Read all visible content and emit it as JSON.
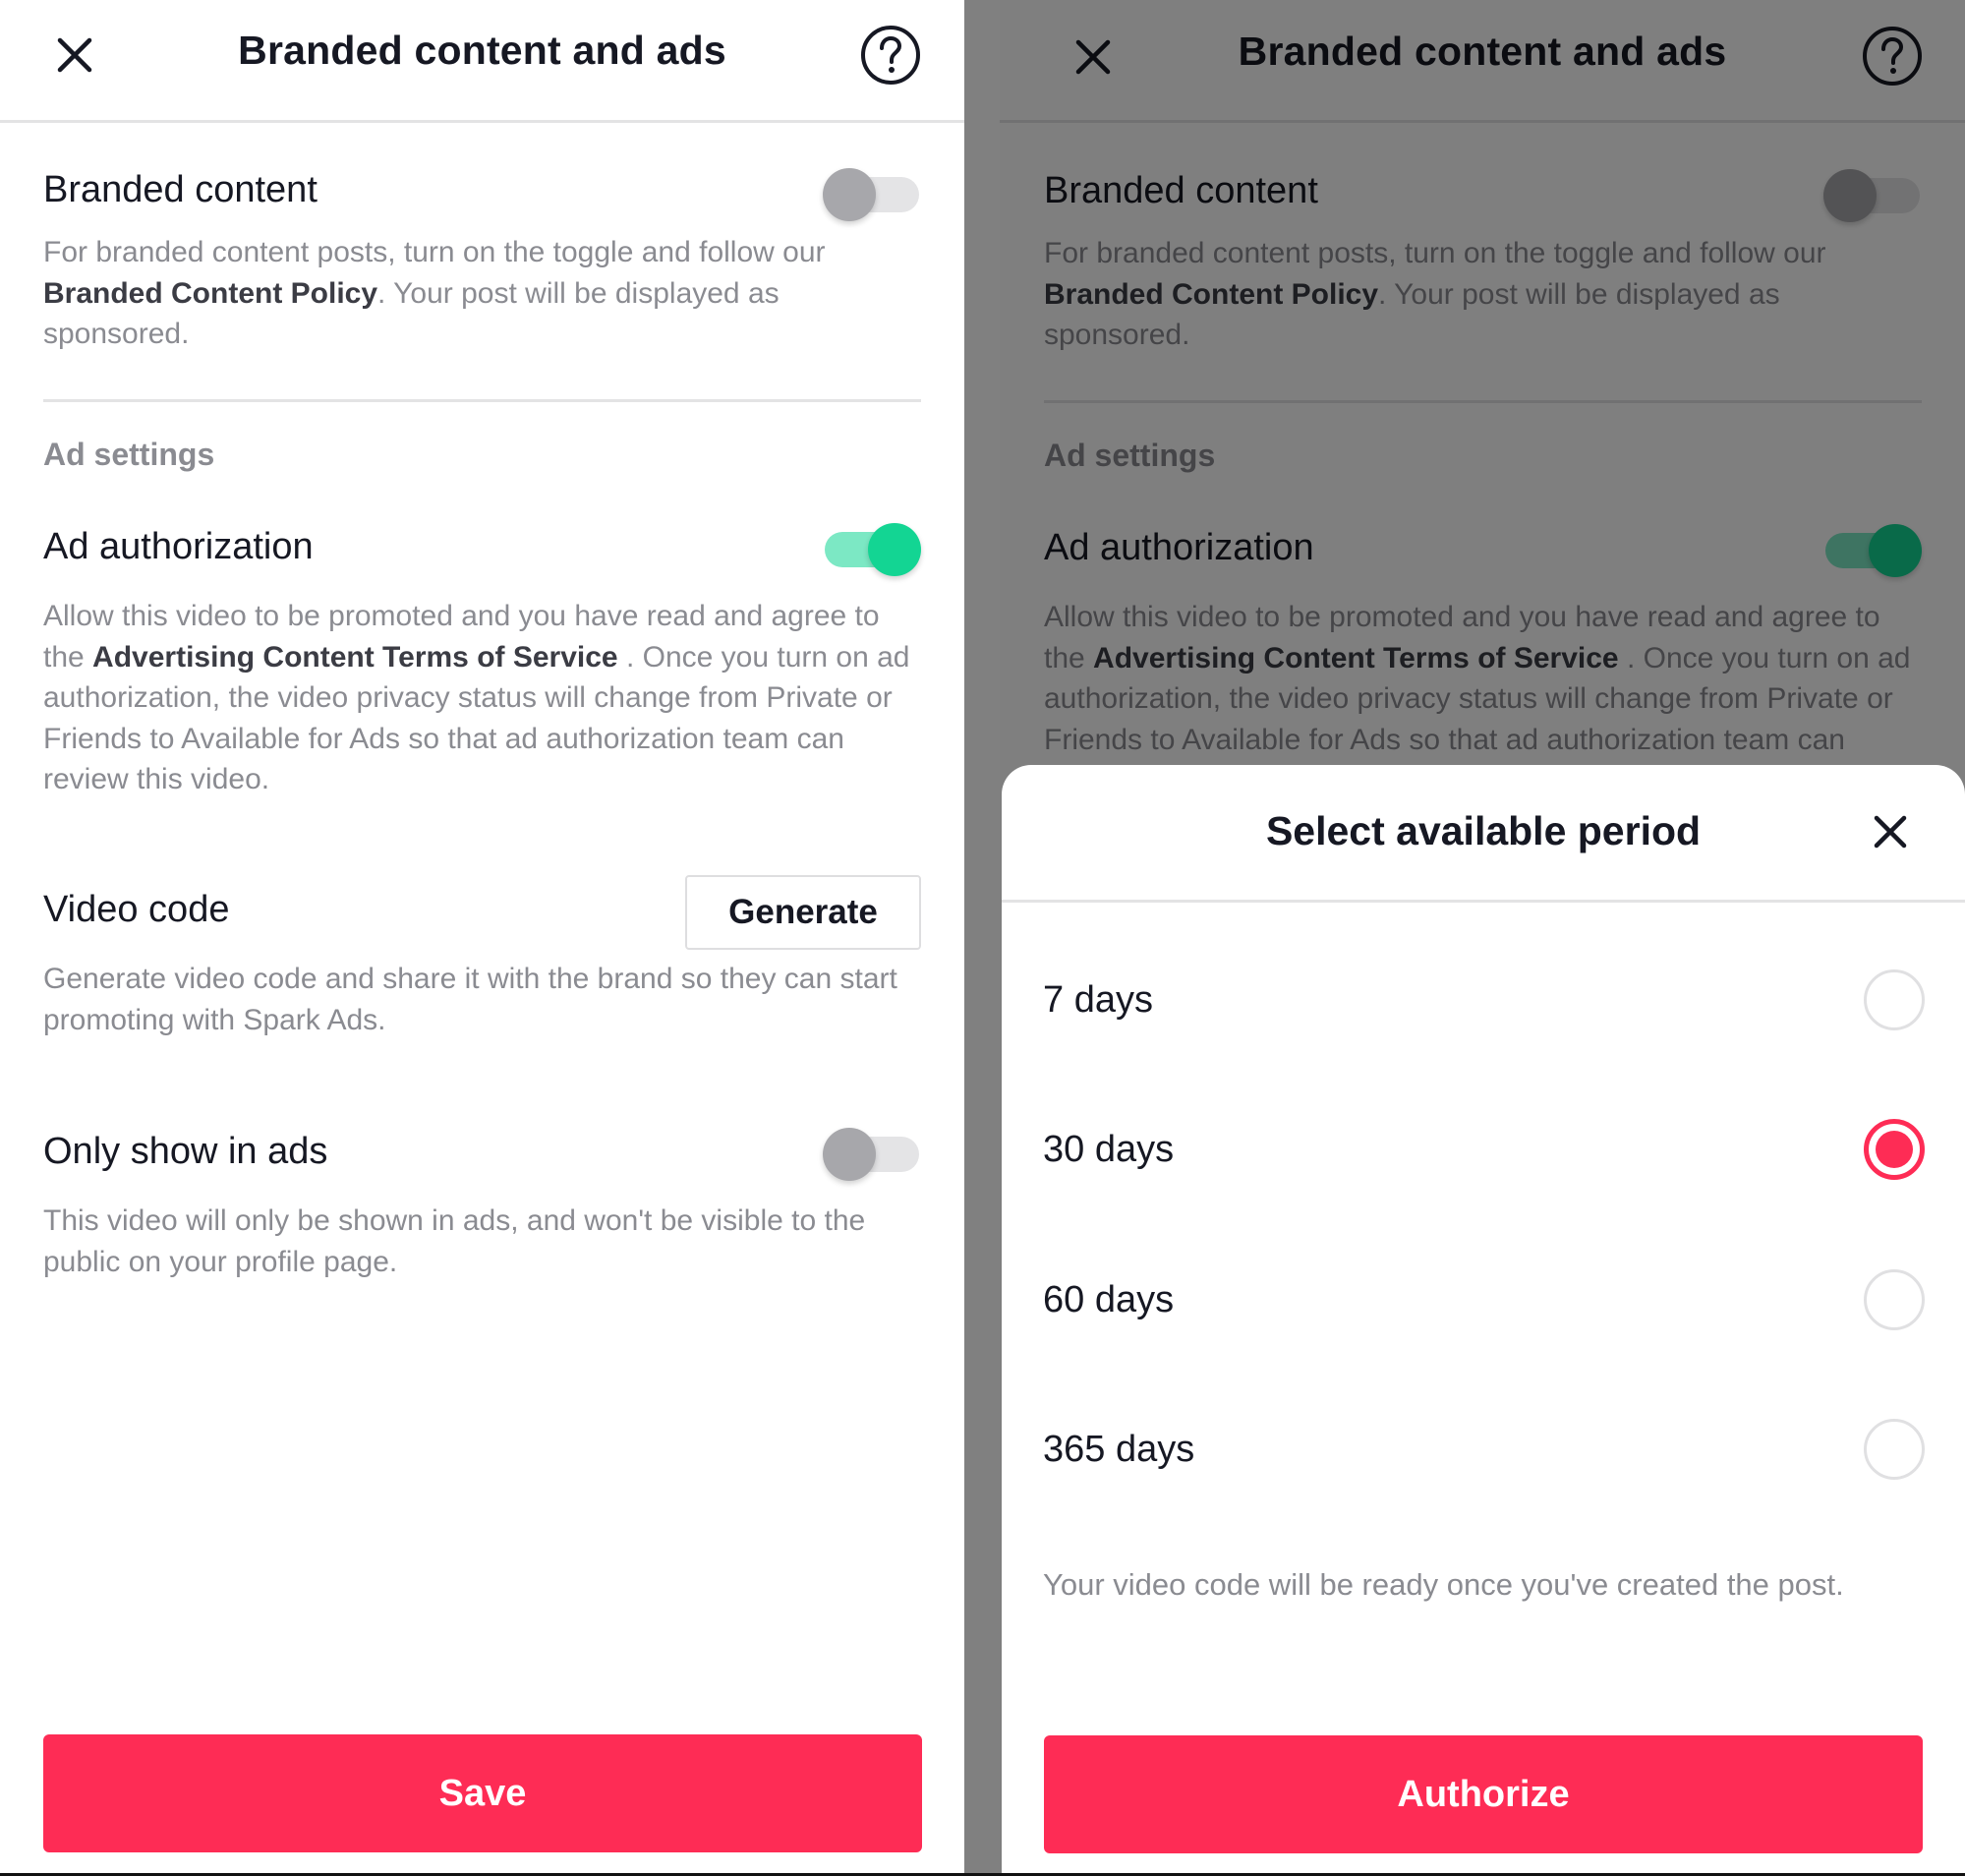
{
  "colors": {
    "brand_red": "#fe2c55",
    "toggle_on": "#13d593",
    "toggle_off": "#a7a7ab",
    "overlay": "#808080"
  },
  "screens": [
    {
      "header": {
        "title": "Branded content and ads",
        "close_icon": "close-icon",
        "help_icon": "help-circle-icon"
      },
      "branded_content": {
        "label": "Branded content",
        "toggle_on": false,
        "desc_pre": "For branded content posts, turn on the toggle and follow our ",
        "desc_link": "Branded Content Policy",
        "desc_post": ". Your post will be displayed as sponsored."
      },
      "ad_settings": {
        "section_title": "Ad settings",
        "ad_authorization": {
          "label": "Ad authorization",
          "toggle_on": true,
          "desc_pre": "Allow this video to be promoted and you have read and agree to the ",
          "desc_link": "Advertising Content Terms of Service",
          "desc_post": " . Once you turn on ad authorization, the video privacy status will change from Private or Friends to Available for Ads so that ad authorization team can review this video."
        },
        "video_code": {
          "label": "Video code",
          "button_label": "Generate",
          "desc": "Generate video code and share it with the brand so they can start promoting with Spark Ads."
        },
        "only_show_in_ads": {
          "label": "Only show in ads",
          "toggle_on": false,
          "desc": "This video will only be shown in ads, and won't be visible to the public on your profile page."
        }
      },
      "primary_button": "Save"
    },
    {
      "header": {
        "title": "Branded content and ads"
      },
      "branded_content": {
        "label": "Branded content",
        "toggle_on": false,
        "desc_pre": "For branded content posts, turn on the toggle and follow our ",
        "desc_link": "Branded Content Policy",
        "desc_post": ". Your post will be displayed as sponsored."
      },
      "ad_settings": {
        "section_title": "Ad settings",
        "ad_authorization": {
          "label": "Ad authorization",
          "toggle_on": true,
          "desc_pre": "Allow this video to be promoted and you have read and agree to the ",
          "desc_link": "Advertising Content Terms of Service",
          "desc_post": " . Once you turn on ad authorization, the video privacy status will change from Private or Friends to Available for Ads so that ad authorization team can review this video."
        }
      },
      "modal": {
        "title": "Select available period",
        "close_icon": "close-icon",
        "options": [
          {
            "label": "7 days",
            "selected": false
          },
          {
            "label": "30 days",
            "selected": true
          },
          {
            "label": "60 days",
            "selected": false
          },
          {
            "label": "365 days",
            "selected": false
          }
        ],
        "note": "Your video code will be ready once you've created the post.",
        "primary_button": "Authorize"
      }
    }
  ]
}
